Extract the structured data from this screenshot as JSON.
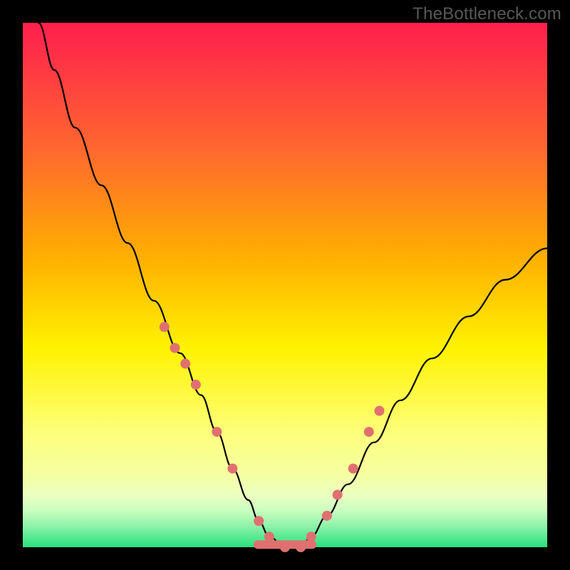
{
  "watermark": "TheBottleneck.com",
  "colors": {
    "gradient_top": "#ff1f4b",
    "gradient_mid1": "#ffb000",
    "gradient_mid2": "#fff200",
    "gradient_mid3": "#f5ffa0",
    "gradient_bottom": "#28e07e",
    "curve": "#000000",
    "marker": "#e07070",
    "frame": "#000000"
  },
  "chart_data": {
    "type": "line",
    "title": "",
    "xlabel": "",
    "ylabel": "",
    "xlim": [
      0,
      100
    ],
    "ylim": [
      0,
      100
    ],
    "x": [
      3,
      6,
      10,
      15,
      20,
      25,
      30,
      34,
      37,
      40,
      43,
      45,
      47,
      50,
      53,
      55,
      58,
      62,
      67,
      72,
      78,
      85,
      92,
      100
    ],
    "values": [
      100,
      91,
      80,
      69,
      58,
      47,
      37,
      29,
      22,
      15,
      9,
      5,
      2,
      0,
      0,
      2,
      6,
      12,
      20,
      28,
      36,
      44,
      51,
      57
    ],
    "minimum_x": 50,
    "minimum_y": 0,
    "markers_x": [
      27,
      29,
      31,
      33,
      37,
      40,
      45,
      47,
      50,
      53,
      55,
      58,
      60,
      63,
      66,
      68
    ],
    "markers_y": [
      42,
      38,
      35,
      31,
      22,
      15,
      5,
      2,
      0,
      0,
      2,
      6,
      10,
      15,
      22,
      26
    ]
  }
}
